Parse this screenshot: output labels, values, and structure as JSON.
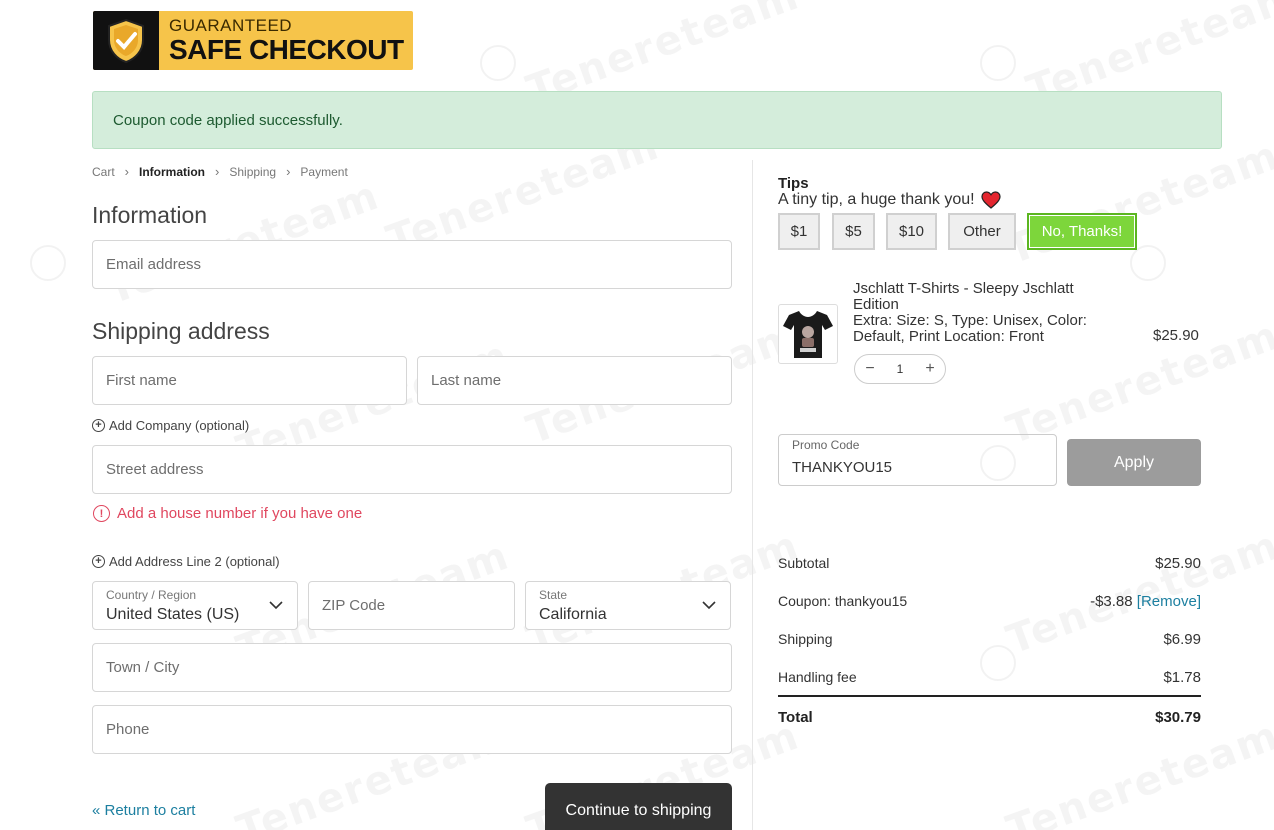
{
  "badge": {
    "line1": "GUARANTEED",
    "line2": "SAFE CHECKOUT"
  },
  "alert": {
    "message": "Coupon code applied successfully."
  },
  "breadcrumb": [
    "Cart",
    "Information",
    "Shipping",
    "Payment"
  ],
  "information": {
    "heading": "Information",
    "email_placeholder": "Email address"
  },
  "shipping": {
    "heading": "Shipping address",
    "first_name_placeholder": "First name",
    "last_name_placeholder": "Last name",
    "add_company": "Add Company (optional)",
    "street_placeholder": "Street address",
    "street_error": "Add a house number if you have one",
    "add_line2": "Add Address Line 2 (optional)",
    "country_label": "Country / Region",
    "country_value": "United States (US)",
    "zip_placeholder": "ZIP Code",
    "state_label": "State",
    "state_value": "California",
    "city_placeholder": "Town / City",
    "phone_placeholder": "Phone"
  },
  "footer": {
    "return_link": "« Return to cart",
    "continue_button": "Continue to shipping"
  },
  "tips": {
    "title": "Tips",
    "subtitle": "A tiny tip, a huge thank you!",
    "options": [
      "$1",
      "$5",
      "$10",
      "Other",
      "No, Thanks!"
    ],
    "selected": "No, Thanks!",
    "selected_color": "#7dd63b"
  },
  "product": {
    "name": "Jschlatt T-Shirts - Sleepy Jschlatt Edition",
    "meta": "Extra: Size: S, Type: Unisex, Color: Default, Print Location: Front",
    "price": "$25.90",
    "quantity": "1"
  },
  "promo": {
    "label": "Promo Code",
    "value": "THANKYOU15",
    "apply_button": "Apply"
  },
  "summary": {
    "subtotal_label": "Subtotal",
    "subtotal_value": "$25.90",
    "coupon_label": "Coupon: thankyou15",
    "coupon_value": "-$3.88",
    "coupon_remove": "[Remove]",
    "shipping_label": "Shipping",
    "shipping_value": "$6.99",
    "handling_label": "Handling fee",
    "handling_value": "$1.78",
    "total_label": "Total",
    "total_value": "$30.79"
  },
  "watermark": "Tenereteam",
  "colors": {
    "error": "#e0475f",
    "link": "#1c7fa0",
    "alert_bg": "#d4eddb",
    "badge": "#f6c44a"
  }
}
